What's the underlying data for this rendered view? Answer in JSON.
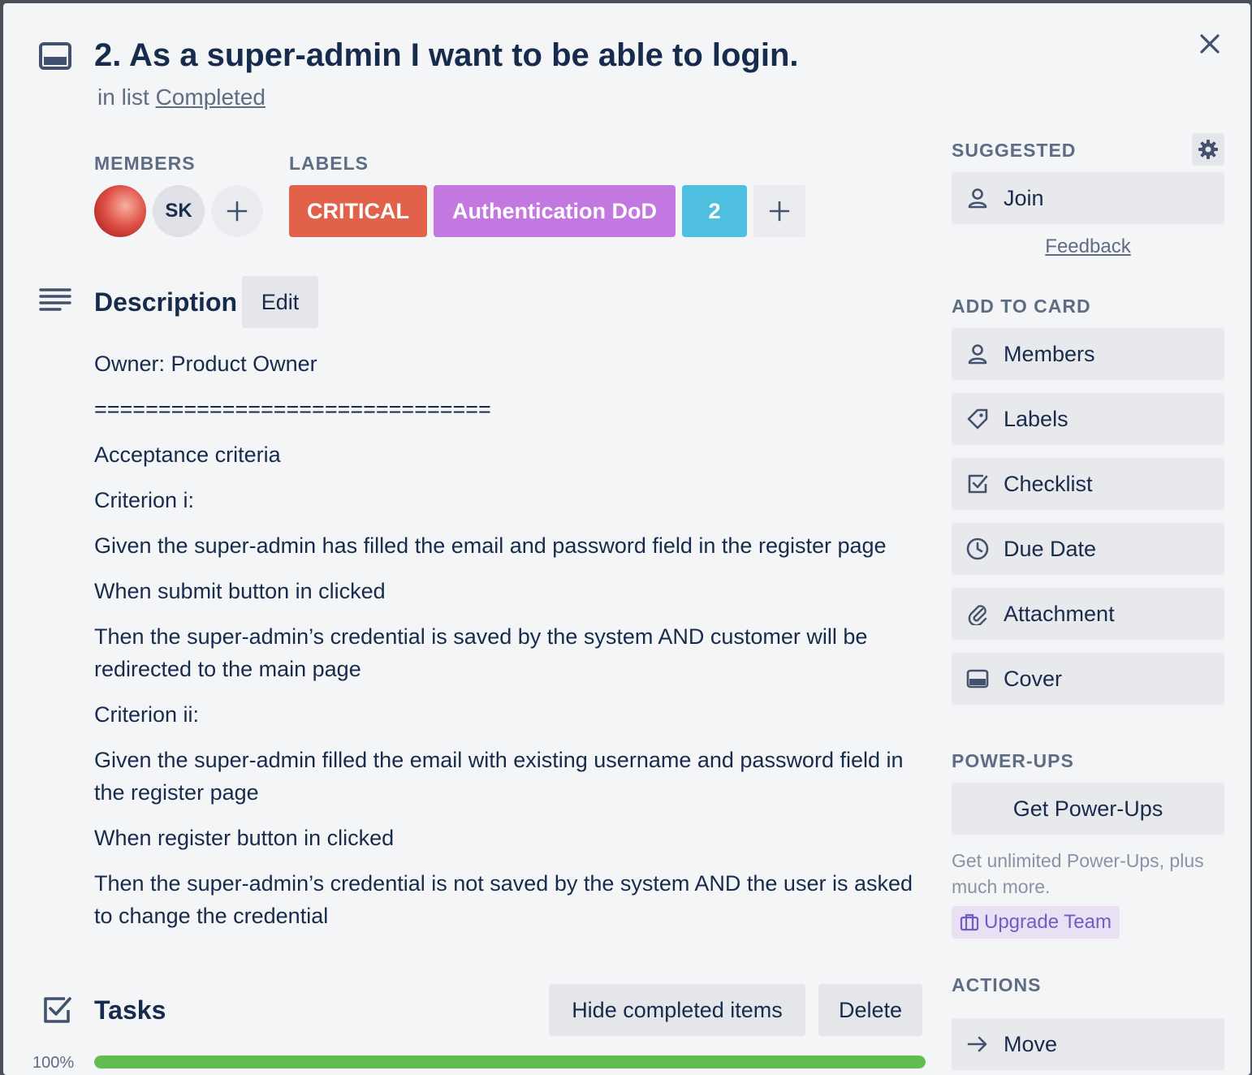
{
  "card": {
    "title": "2. As a super-admin I want to be able to login.",
    "in_list_prefix": "in list",
    "list_name": "Completed"
  },
  "members": {
    "heading": "MEMBERS",
    "avatars": [
      "SK"
    ]
  },
  "labels": {
    "heading": "LABELS",
    "items": [
      {
        "text": "CRITICAL",
        "color": "#e2614b"
      },
      {
        "text": "Authentication DoD",
        "color": "#c377e0"
      },
      {
        "text": "2",
        "color": "#4fbfe0"
      }
    ]
  },
  "description": {
    "heading": "Description",
    "edit_label": "Edit",
    "lines": [
      "Owner: Product Owner",
      "===============================",
      "Acceptance criteria",
      "Criterion i:",
      "Given the super-admin has filled the email and password field in the register page",
      "When submit button in clicked",
      "Then the super-admin’s credential is saved by the system AND customer will be redirected to the main page",
      "Criterion ii:",
      "Given the super-admin filled the email with existing username and password field in the register page",
      "When register button in clicked",
      "Then the super-admin’s credential is not saved by the system AND the user is asked to change the credential"
    ]
  },
  "tasks": {
    "heading": "Tasks",
    "hide_completed_label": "Hide completed items",
    "delete_label": "Delete",
    "progress_text": "100%",
    "progress_value": 1.0
  },
  "sidebar": {
    "suggested_heading": "SUGGESTED",
    "join_label": "Join",
    "feedback_label": "Feedback",
    "add_to_card_heading": "ADD TO CARD",
    "add_items": [
      {
        "label": "Members",
        "icon": "person-icon"
      },
      {
        "label": "Labels",
        "icon": "tag-icon"
      },
      {
        "label": "Checklist",
        "icon": "checklist-icon"
      },
      {
        "label": "Due Date",
        "icon": "clock-icon"
      },
      {
        "label": "Attachment",
        "icon": "paperclip-icon"
      },
      {
        "label": "Cover",
        "icon": "cover-icon"
      }
    ],
    "powerups_heading": "POWER-UPS",
    "get_powerups_label": "Get Power-Ups",
    "powerups_note": "Get unlimited Power-Ups, plus much more.",
    "upgrade_label": "Upgrade Team",
    "actions_heading": "ACTIONS",
    "move_label": "Move"
  },
  "colors": {
    "accent_green": "#61bd4f",
    "text_primary": "#172b4d",
    "text_secondary": "#5e6c84"
  }
}
